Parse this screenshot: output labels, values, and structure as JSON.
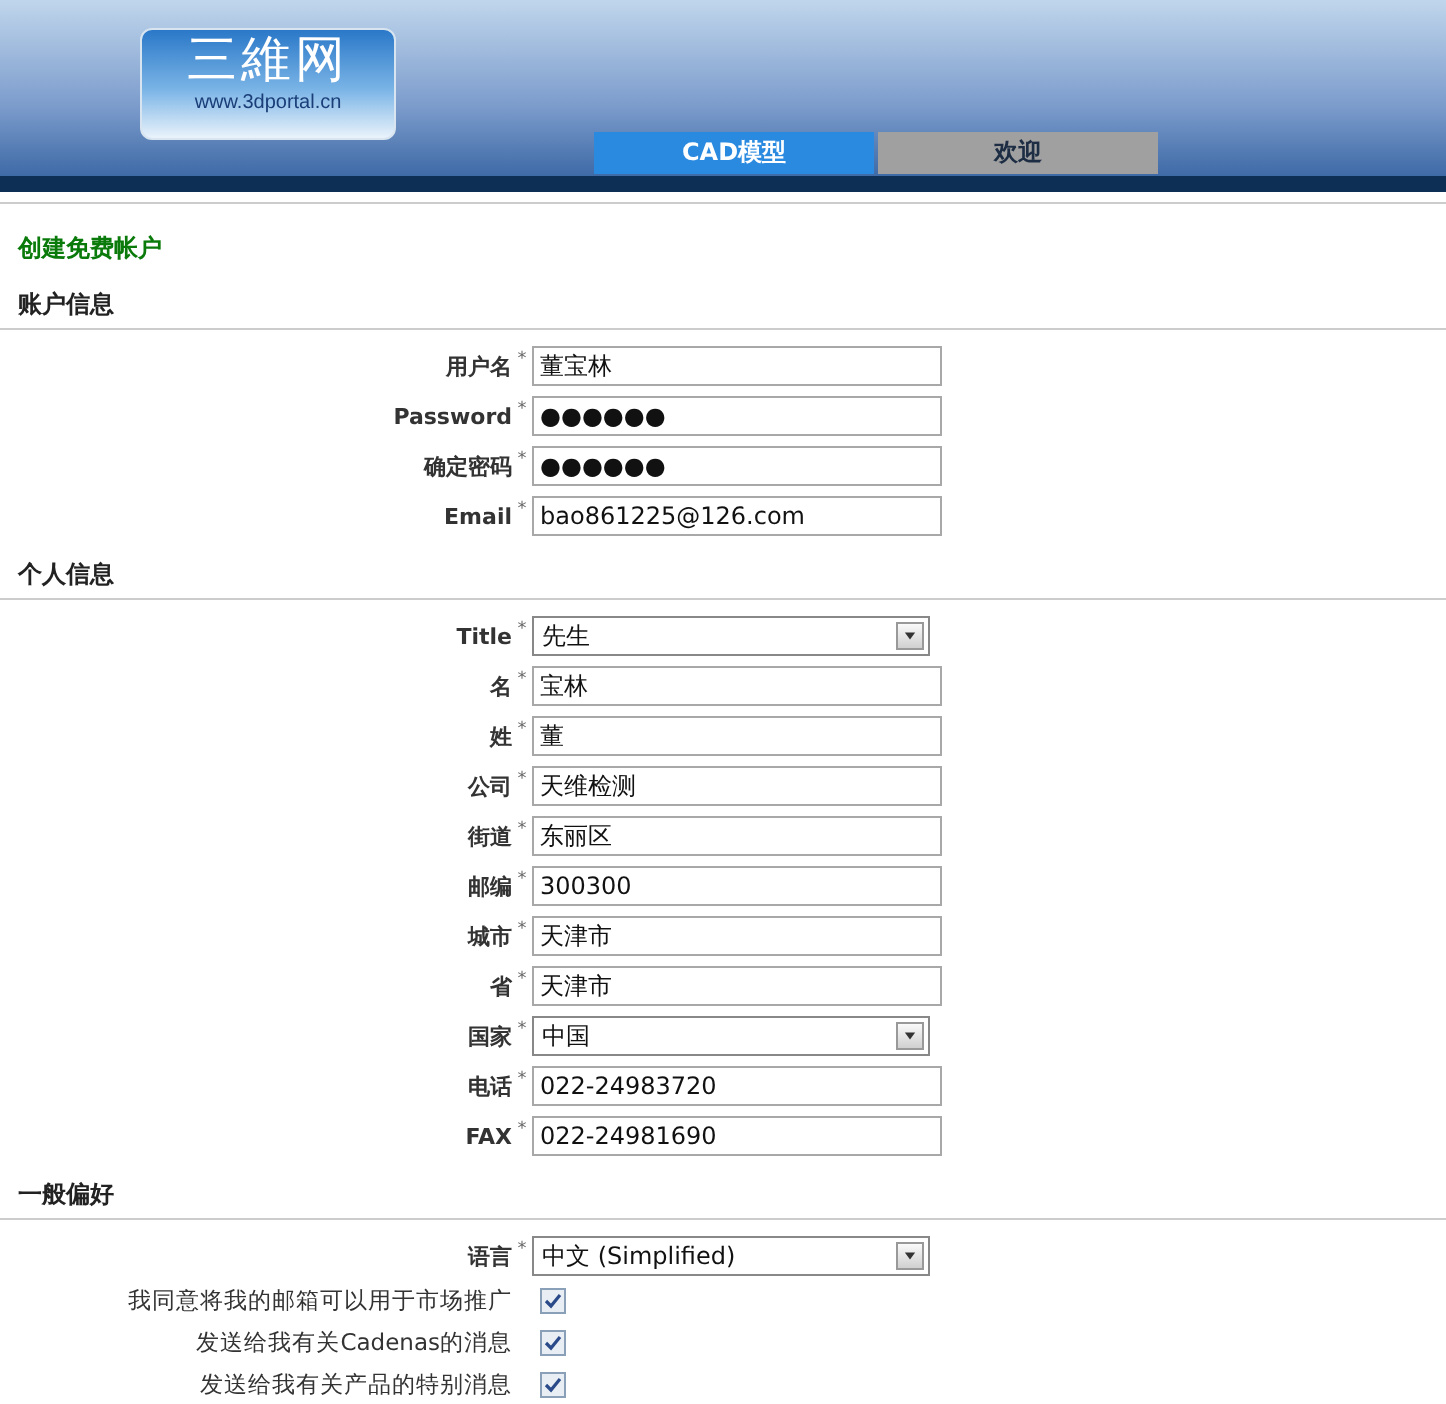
{
  "header": {
    "logo": {
      "title": "三維网",
      "url": "www.3dportal.cn"
    },
    "tabs": [
      {
        "label": "CAD模型",
        "selected": true
      },
      {
        "label": "欢迎",
        "selected": false
      }
    ]
  },
  "page_title": "创建免费帐户",
  "sections": [
    {
      "title": "账户信息",
      "fields": [
        {
          "kind": "text",
          "label": "用户名",
          "mark": "*",
          "value": "董宝林"
        },
        {
          "kind": "text",
          "label": "Password",
          "mark": "*",
          "value": "●●●●●●"
        },
        {
          "kind": "text",
          "label": "确定密码",
          "mark": "*",
          "value": "●●●●●●"
        },
        {
          "kind": "text",
          "label": "Email",
          "mark": "*",
          "value": "bao861225@126.com"
        }
      ]
    },
    {
      "title": "个人信息",
      "fields": [
        {
          "kind": "select",
          "label": "Title",
          "mark": "*",
          "value": "先生"
        },
        {
          "kind": "text",
          "label": "名",
          "mark": "*",
          "value": "宝林"
        },
        {
          "kind": "text",
          "label": "姓",
          "mark": "*",
          "value": "董"
        },
        {
          "kind": "text",
          "label": "公司",
          "mark": "*",
          "value": "天维检测"
        },
        {
          "kind": "text",
          "label": "街道",
          "mark": "*",
          "value": "东丽区"
        },
        {
          "kind": "text",
          "label": "邮编",
          "mark": "*",
          "value": "300300"
        },
        {
          "kind": "text",
          "label": "城市",
          "mark": "*",
          "value": "天津市"
        },
        {
          "kind": "text",
          "label": "省",
          "mark": "*",
          "value": "天津市"
        },
        {
          "kind": "select",
          "label": "国家",
          "mark": "*",
          "value": "中国"
        },
        {
          "kind": "text",
          "label": "电话",
          "mark": "*",
          "value": "022-24983720"
        },
        {
          "kind": "text",
          "label": "FAX",
          "mark": "*",
          "value": "022-24981690"
        }
      ]
    },
    {
      "title": "一般偏好",
      "fields": [
        {
          "kind": "select",
          "label": "语言",
          "mark": "*",
          "value": "中文 (Simplified)"
        },
        {
          "kind": "checkbox",
          "label": "我同意将我的邮箱可以用于市场推广",
          "checked": true
        },
        {
          "kind": "checkbox",
          "label": "发送给我有关Cadenas的消息",
          "checked": true
        },
        {
          "kind": "checkbox",
          "label": "发送给我有关产品的特别消息",
          "checked": true
        }
      ]
    }
  ]
}
